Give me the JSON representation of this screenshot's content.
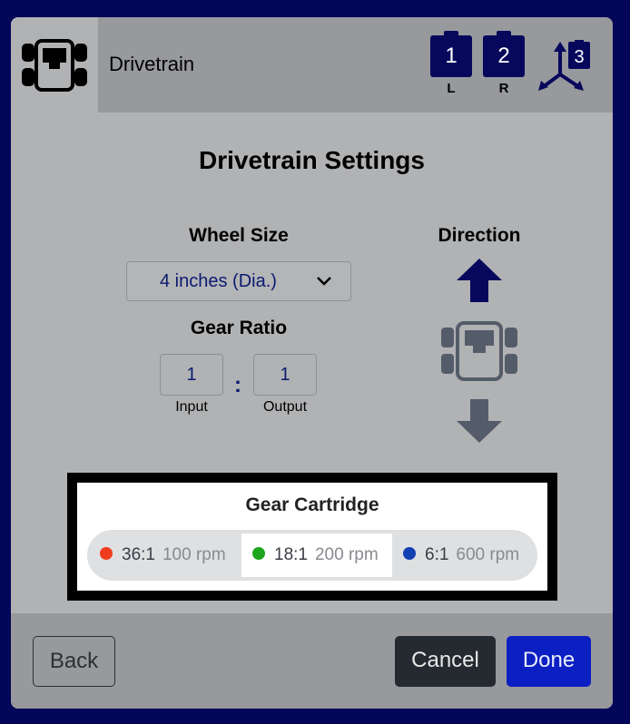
{
  "header": {
    "title": "Drivetrain",
    "ports": [
      {
        "number": "1",
        "caption": "L"
      },
      {
        "number": "2",
        "caption": "R"
      }
    ],
    "gyro_port": "3"
  },
  "settings": {
    "title": "Drivetrain Settings",
    "wheel_size": {
      "label": "Wheel Size",
      "value": "4 inches (Dia.)"
    },
    "gear_ratio": {
      "label": "Gear Ratio",
      "input_value": "1",
      "output_value": "1",
      "input_caption": "Input",
      "output_caption": "Output",
      "separator": ":"
    },
    "direction": {
      "label": "Direction"
    }
  },
  "gear_cartridge": {
    "title": "Gear Cartridge",
    "selected": "18:1",
    "options": [
      {
        "ratio": "36:1",
        "rpm": "100 rpm",
        "color": "#f03c1e"
      },
      {
        "ratio": "18:1",
        "rpm": "200 rpm",
        "color": "#1ea51e"
      },
      {
        "ratio": "6:1",
        "rpm": "600 rpm",
        "color": "#1440b4"
      }
    ]
  },
  "footer": {
    "back_label": "Back",
    "cancel_label": "Cancel",
    "done_label": "Done"
  },
  "colors": {
    "accent": "#0c1fc2",
    "navy": "#07085c",
    "forward_arrow": "#07085c",
    "reverse_arrow": "#555c69"
  }
}
